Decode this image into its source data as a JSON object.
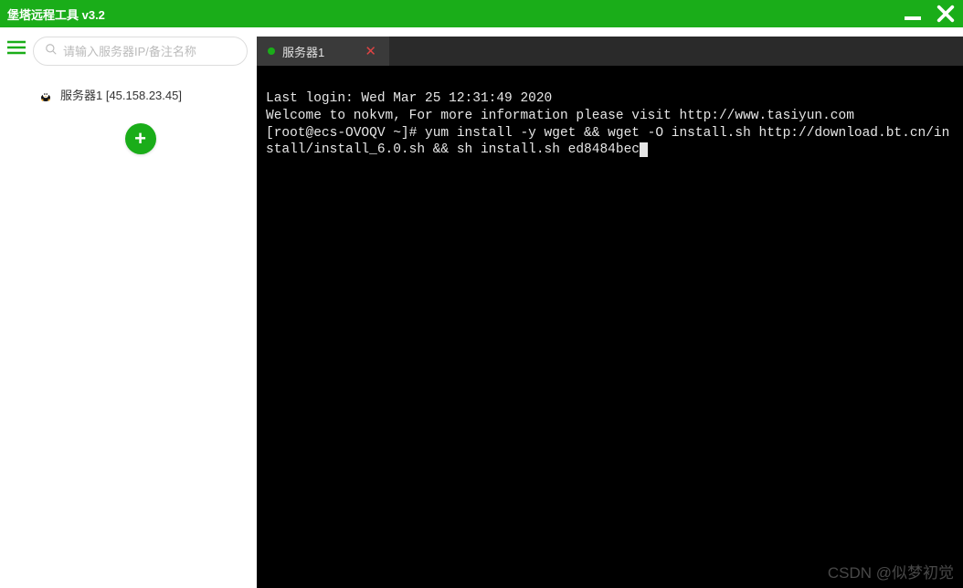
{
  "titlebar": {
    "title": "堡塔远程工具  v3.2"
  },
  "sidebar": {
    "search_placeholder": "请输入服务器IP/备注名称",
    "servers": [
      {
        "label": "服务器1 [45.158.23.45]"
      }
    ]
  },
  "tabs": [
    {
      "label": "服务器1",
      "active": true
    }
  ],
  "terminal": {
    "line1": "Last login: Wed Mar 25 12:31:49 2020",
    "line2": "Welcome to nokvm, For more information please visit http://www.tasiyun.com",
    "line3": "[root@ecs-OVOQV ~]# yum install -y wget && wget -O install.sh http://download.bt.cn/install/install_6.0.sh && sh install.sh ed8484bec"
  },
  "watermark": "CSDN @似梦初觉"
}
